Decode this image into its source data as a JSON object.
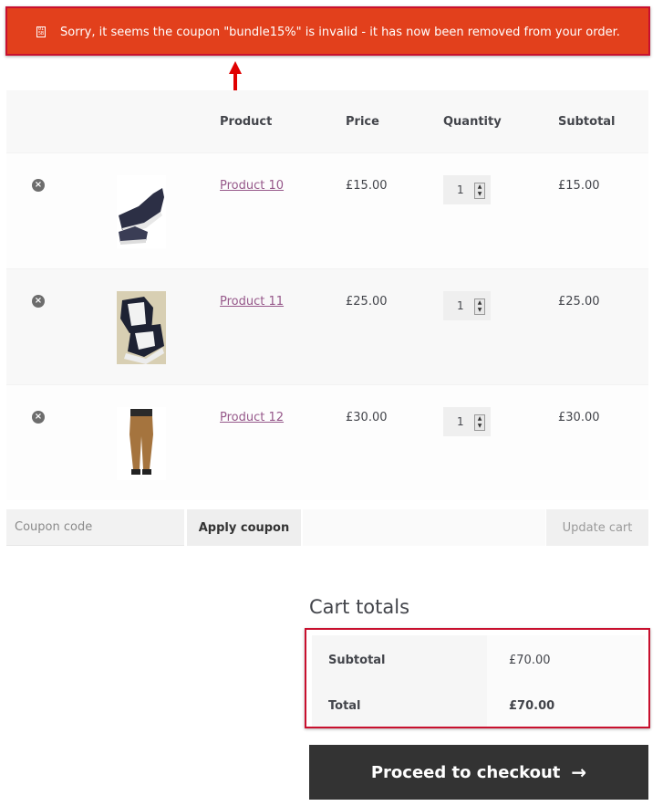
{
  "notice": {
    "message": "Sorry, it seems the coupon \"bundle15%\" is invalid - it has now been removed from your order.",
    "icon": "error-icon",
    "color": "#e2401c"
  },
  "cart": {
    "headers": {
      "product": "Product",
      "price": "Price",
      "quantity": "Quantity",
      "subtotal": "Subtotal"
    },
    "items": [
      {
        "name": "Product 10",
        "price": "£15.00",
        "quantity": "1",
        "subtotal": "£15.00",
        "image": "shoe-dark"
      },
      {
        "name": "Product 11",
        "price": "£25.00",
        "quantity": "1",
        "subtotal": "£25.00",
        "image": "sneakers-laced"
      },
      {
        "name": "Product 12",
        "price": "£30.00",
        "quantity": "1",
        "subtotal": "£30.00",
        "image": "trousers"
      }
    ]
  },
  "coupon": {
    "placeholder": "Coupon code",
    "apply_label": "Apply coupon",
    "update_label": "Update cart"
  },
  "totals": {
    "title": "Cart totals",
    "subtotal_label": "Subtotal",
    "subtotal_value": "£70.00",
    "total_label": "Total",
    "total_value": "£70.00"
  },
  "checkout": {
    "label": "Proceed to checkout",
    "arrow": "→"
  },
  "colors": {
    "highlight": "#c8102e",
    "link": "#96588a",
    "dark_button": "#333333"
  }
}
